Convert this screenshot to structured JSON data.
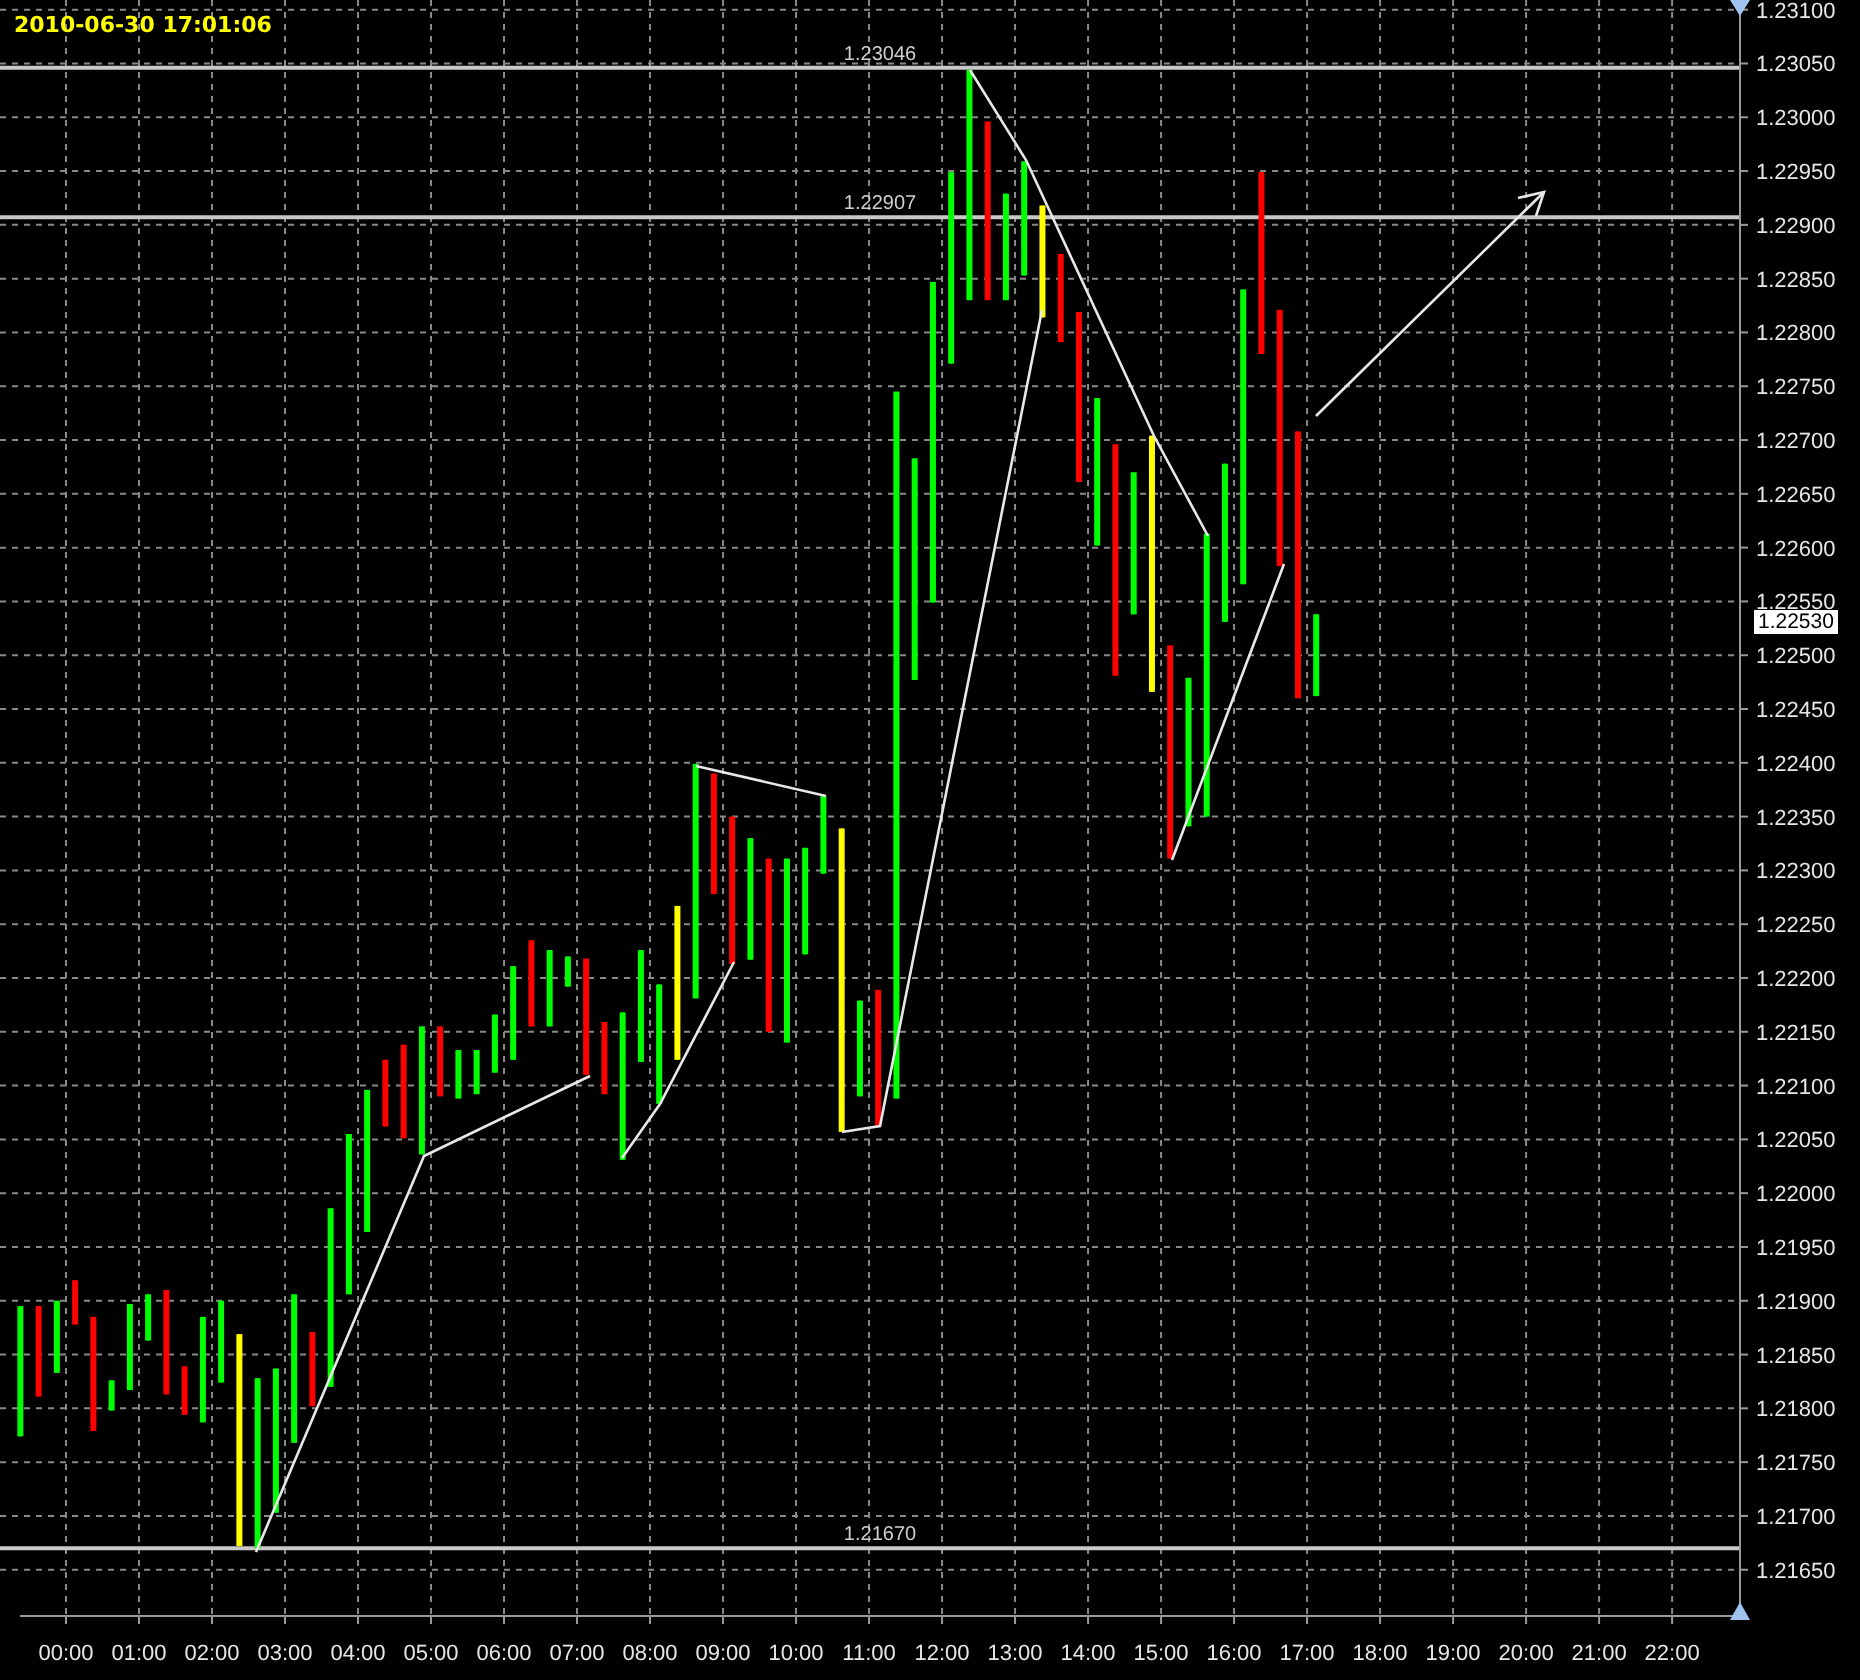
{
  "timestamp": "2010-06-30 17:01:06",
  "chart": {
    "last_price": "1.22530",
    "chart_data": {
      "type": "candlestick",
      "xlim": [
        -0.904,
        22.93
      ],
      "ylim": [
        1.21607,
        1.23109
      ],
      "xticks": [
        {
          "value": 0,
          "label": "00:00"
        },
        {
          "value": 1,
          "label": "01:00"
        },
        {
          "value": 2,
          "label": "02:00"
        },
        {
          "value": 3,
          "label": "03:00"
        },
        {
          "value": 4,
          "label": "04:00"
        },
        {
          "value": 5,
          "label": "05:00"
        },
        {
          "value": 6,
          "label": "06:00"
        },
        {
          "value": 7,
          "label": "07:00"
        },
        {
          "value": 8,
          "label": "08:00"
        },
        {
          "value": 9,
          "label": "09:00"
        },
        {
          "value": 10,
          "label": "10:00"
        },
        {
          "value": 11,
          "label": "11:00"
        },
        {
          "value": 12,
          "label": "12:00"
        },
        {
          "value": 13,
          "label": "13:00"
        },
        {
          "value": 14,
          "label": "14:00"
        },
        {
          "value": 15,
          "label": "15:00"
        },
        {
          "value": 16,
          "label": "16:00"
        },
        {
          "value": 17,
          "label": "17:00"
        },
        {
          "value": 18,
          "label": "18:00"
        },
        {
          "value": 19,
          "label": "19:00"
        },
        {
          "value": 20,
          "label": "20:00"
        },
        {
          "value": 21,
          "label": "21:00"
        },
        {
          "value": 22,
          "label": "22:00"
        }
      ],
      "yticks": [
        {
          "value": 1.231,
          "label": "1.23100"
        },
        {
          "value": 1.2305,
          "label": "1.23050"
        },
        {
          "value": 1.23,
          "label": "1.23000"
        },
        {
          "value": 1.2295,
          "label": "1.22950"
        },
        {
          "value": 1.229,
          "label": "1.22900"
        },
        {
          "value": 1.2285,
          "label": "1.22850"
        },
        {
          "value": 1.228,
          "label": "1.22800"
        },
        {
          "value": 1.2275,
          "label": "1.22750"
        },
        {
          "value": 1.227,
          "label": "1.22700"
        },
        {
          "value": 1.2265,
          "label": "1.22650"
        },
        {
          "value": 1.226,
          "label": "1.22600"
        },
        {
          "value": 1.2255,
          "label": "1.22550"
        },
        {
          "value": 1.225,
          "label": "1.22500"
        },
        {
          "value": 1.2245,
          "label": "1.22450"
        },
        {
          "value": 1.224,
          "label": "1.22400"
        },
        {
          "value": 1.2235,
          "label": "1.22350"
        },
        {
          "value": 1.223,
          "label": "1.22300"
        },
        {
          "value": 1.2225,
          "label": "1.22250"
        },
        {
          "value": 1.222,
          "label": "1.22200"
        },
        {
          "value": 1.2215,
          "label": "1.22150"
        },
        {
          "value": 1.221,
          "label": "1.22100"
        },
        {
          "value": 1.2205,
          "label": "1.22050"
        },
        {
          "value": 1.22,
          "label": "1.22000"
        },
        {
          "value": 1.2195,
          "label": "1.21950"
        },
        {
          "value": 1.219,
          "label": "1.21900"
        },
        {
          "value": 1.2185,
          "label": "1.21850"
        },
        {
          "value": 1.218,
          "label": "1.21800"
        },
        {
          "value": 1.2175,
          "label": "1.21750"
        },
        {
          "value": 1.217,
          "label": "1.21700"
        },
        {
          "value": 1.2165,
          "label": "1.21650"
        }
      ],
      "x": [
        -0.625,
        -0.375,
        -0.125,
        0.125,
        0.375,
        0.625,
        0.875,
        1.125,
        1.375,
        1.625,
        1.875,
        2.125,
        2.375,
        2.625,
        2.875,
        3.125,
        3.375,
        3.625,
        3.875,
        4.125,
        4.375,
        4.625,
        4.875,
        5.125,
        5.375,
        5.625,
        5.875,
        6.125,
        6.375,
        6.625,
        6.875,
        7.125,
        7.375,
        7.625,
        7.875,
        8.125,
        8.375,
        8.625,
        8.875,
        9.125,
        9.375,
        9.625,
        9.875,
        10.125,
        10.375,
        10.625,
        10.875,
        11.125,
        11.375,
        11.625,
        11.875,
        12.125,
        12.375,
        12.625,
        12.875,
        13.125,
        13.375,
        13.625,
        13.875,
        14.125,
        14.375,
        14.625,
        14.875,
        15.125,
        15.375,
        15.625,
        15.875,
        16.125,
        16.375,
        16.625,
        16.875,
        17.125
      ],
      "series": [
        {
          "color": "#00ff00",
          "ohlc": [
            [
              1.21774,
              1.21895,
              1.21774,
              1.21895
            ],
            null,
            [
              1.21833,
              1.219,
              1.21833,
              1.219
            ],
            null,
            null,
            [
              1.21798,
              1.21826,
              1.21798,
              1.21826
            ],
            [
              1.21817,
              1.21897,
              1.21817,
              1.21897
            ],
            [
              1.21863,
              1.21906,
              1.21863,
              1.21906
            ],
            null,
            null,
            [
              1.21787,
              1.21885,
              1.21787,
              1.21885
            ],
            [
              1.21824,
              1.219,
              1.21824,
              1.219
            ],
            null,
            [
              1.2167,
              1.21828,
              1.2167,
              1.21828
            ],
            [
              1.21703,
              1.21837,
              1.21703,
              1.21837
            ],
            [
              1.21768,
              1.21906,
              1.21768,
              1.21906
            ],
            null,
            [
              1.2182,
              1.21986,
              1.2182,
              1.21986
            ],
            [
              1.21906,
              1.22055,
              1.21906,
              1.22055
            ],
            [
              1.21964,
              1.22096,
              1.21964,
              1.22096
            ],
            null,
            null,
            [
              1.22036,
              1.22155,
              1.22036,
              1.22155
            ],
            null,
            [
              1.22088,
              1.22133,
              1.22088,
              1.22133
            ],
            [
              1.22092,
              1.22133,
              1.22092,
              1.22133
            ],
            [
              1.22112,
              1.22166,
              1.22112,
              1.22166
            ],
            [
              1.22124,
              1.22211,
              1.22124,
              1.22211
            ],
            null,
            [
              1.22155,
              1.22226,
              1.22155,
              1.22226
            ],
            [
              1.22192,
              1.2222,
              1.22192,
              1.2222
            ],
            null,
            null,
            [
              1.22031,
              1.22168,
              1.22031,
              1.22168
            ],
            [
              1.22122,
              1.22226,
              1.22122,
              1.22226
            ],
            [
              1.22083,
              1.22194,
              1.22083,
              1.22194
            ],
            null,
            [
              1.22181,
              1.22399,
              1.22181,
              1.22399
            ],
            null,
            null,
            [
              1.22217,
              1.2233,
              1.22217,
              1.2233
            ],
            null,
            [
              1.2214,
              1.22311,
              1.2214,
              1.22311
            ],
            [
              1.22222,
              1.22321,
              1.22222,
              1.22321
            ],
            [
              1.22297,
              1.22369,
              1.22297,
              1.22369
            ],
            null,
            [
              1.2209,
              1.22179,
              1.2209,
              1.22179
            ],
            null,
            [
              1.22088,
              1.22745,
              1.22088,
              1.22745
            ],
            [
              1.22477,
              1.22683,
              1.22477,
              1.22683
            ],
            [
              1.22549,
              1.22847,
              1.22549,
              1.22847
            ],
            [
              1.22771,
              1.22949,
              1.22771,
              1.22949
            ],
            [
              1.2283,
              1.23044,
              1.2283,
              1.23044
            ],
            null,
            [
              1.2283,
              1.22929,
              1.2283,
              1.22929
            ],
            [
              1.22853,
              1.22959,
              1.22853,
              1.22959
            ],
            null,
            null,
            null,
            [
              1.22602,
              1.22739,
              1.22602,
              1.22739
            ],
            null,
            [
              1.22538,
              1.2267,
              1.22538,
              1.2267
            ],
            null,
            null,
            [
              1.22341,
              1.22479,
              1.22341,
              1.22479
            ],
            [
              1.2235,
              1.22613,
              1.2235,
              1.22613
            ],
            [
              1.22531,
              1.22678,
              1.22531,
              1.22678
            ],
            [
              1.22566,
              1.2284,
              1.22566,
              1.2284
            ],
            null,
            null,
            null,
            [
              1.22462,
              1.22538,
              1.22462,
              1.22538
            ]
          ]
        },
        {
          "color": "#ff0000",
          "ohlc": [
            null,
            [
              1.21895,
              1.21895,
              1.21811,
              1.21811
            ],
            null,
            [
              1.21919,
              1.21919,
              1.21878,
              1.21878
            ],
            [
              1.21885,
              1.21885,
              1.21779,
              1.21779
            ],
            null,
            null,
            null,
            [
              1.2191,
              1.2191,
              1.21813,
              1.21813
            ],
            [
              1.21839,
              1.21839,
              1.21794,
              1.21794
            ],
            null,
            null,
            null,
            null,
            null,
            null,
            [
              1.21871,
              1.21871,
              1.21802,
              1.21802
            ],
            null,
            null,
            null,
            [
              1.22124,
              1.22124,
              1.22062,
              1.22062
            ],
            [
              1.22138,
              1.22138,
              1.22051,
              1.22051
            ],
            null,
            [
              1.22155,
              1.22155,
              1.2209,
              1.2209
            ],
            null,
            null,
            null,
            null,
            [
              1.22235,
              1.22235,
              1.22155,
              1.22155
            ],
            null,
            null,
            [
              1.22218,
              1.22218,
              1.2211,
              1.2211
            ],
            [
              1.22159,
              1.22159,
              1.22092,
              1.22092
            ],
            null,
            null,
            null,
            null,
            null,
            [
              1.2239,
              1.2239,
              1.22278,
              1.22278
            ],
            [
              1.2235,
              1.2235,
              1.22213,
              1.22213
            ],
            null,
            [
              1.22311,
              1.22311,
              1.2215,
              1.2215
            ],
            null,
            null,
            null,
            null,
            null,
            [
              1.22189,
              1.22189,
              1.22062,
              1.22062
            ],
            null,
            null,
            null,
            null,
            null,
            [
              1.22996,
              1.22996,
              1.2283,
              1.2283
            ],
            null,
            null,
            null,
            [
              1.22873,
              1.22873,
              1.22791,
              1.22791
            ],
            [
              1.22819,
              1.22819,
              1.22661,
              1.22661
            ],
            null,
            [
              1.22696,
              1.22696,
              1.22481,
              1.22481
            ],
            null,
            null,
            [
              1.22509,
              1.22509,
              1.22311,
              1.22311
            ],
            null,
            null,
            null,
            null,
            [
              1.22949,
              1.22949,
              1.2278,
              1.2278
            ],
            [
              1.22821,
              1.22821,
              1.22583,
              1.22583
            ],
            [
              1.22708,
              1.22708,
              1.2246,
              1.2246
            ],
            null
          ]
        },
        {
          "color": "#ffff00",
          "ohlc": [
            null,
            null,
            null,
            null,
            null,
            null,
            null,
            null,
            null,
            null,
            null,
            null,
            [
              1.21869,
              1.21869,
              1.21672,
              1.21672
            ],
            null,
            null,
            null,
            null,
            null,
            null,
            null,
            null,
            null,
            null,
            null,
            null,
            null,
            null,
            null,
            null,
            null,
            null,
            null,
            null,
            null,
            null,
            null,
            [
              1.22267,
              1.22267,
              1.22124,
              1.22124
            ],
            null,
            null,
            null,
            null,
            null,
            null,
            null,
            null,
            [
              1.22339,
              1.22339,
              1.22057,
              1.22057
            ],
            null,
            null,
            null,
            null,
            null,
            null,
            null,
            null,
            null,
            null,
            [
              1.22918,
              1.22918,
              1.22814,
              1.22814
            ],
            null,
            null,
            null,
            null,
            null,
            [
              1.22704,
              1.22704,
              1.22466,
              1.22466
            ],
            null,
            null,
            null,
            null,
            null,
            null,
            null,
            null,
            null
          ]
        }
      ],
      "grid": true,
      "ref_lines": [
        {
          "axis": "y",
          "value": 1.23046,
          "label": "1.23046"
        },
        {
          "axis": "y",
          "value": 1.22907,
          "label": "1.22907"
        },
        {
          "axis": "y",
          "value": 1.2167,
          "label": "1.21670"
        }
      ]
    }
  }
}
